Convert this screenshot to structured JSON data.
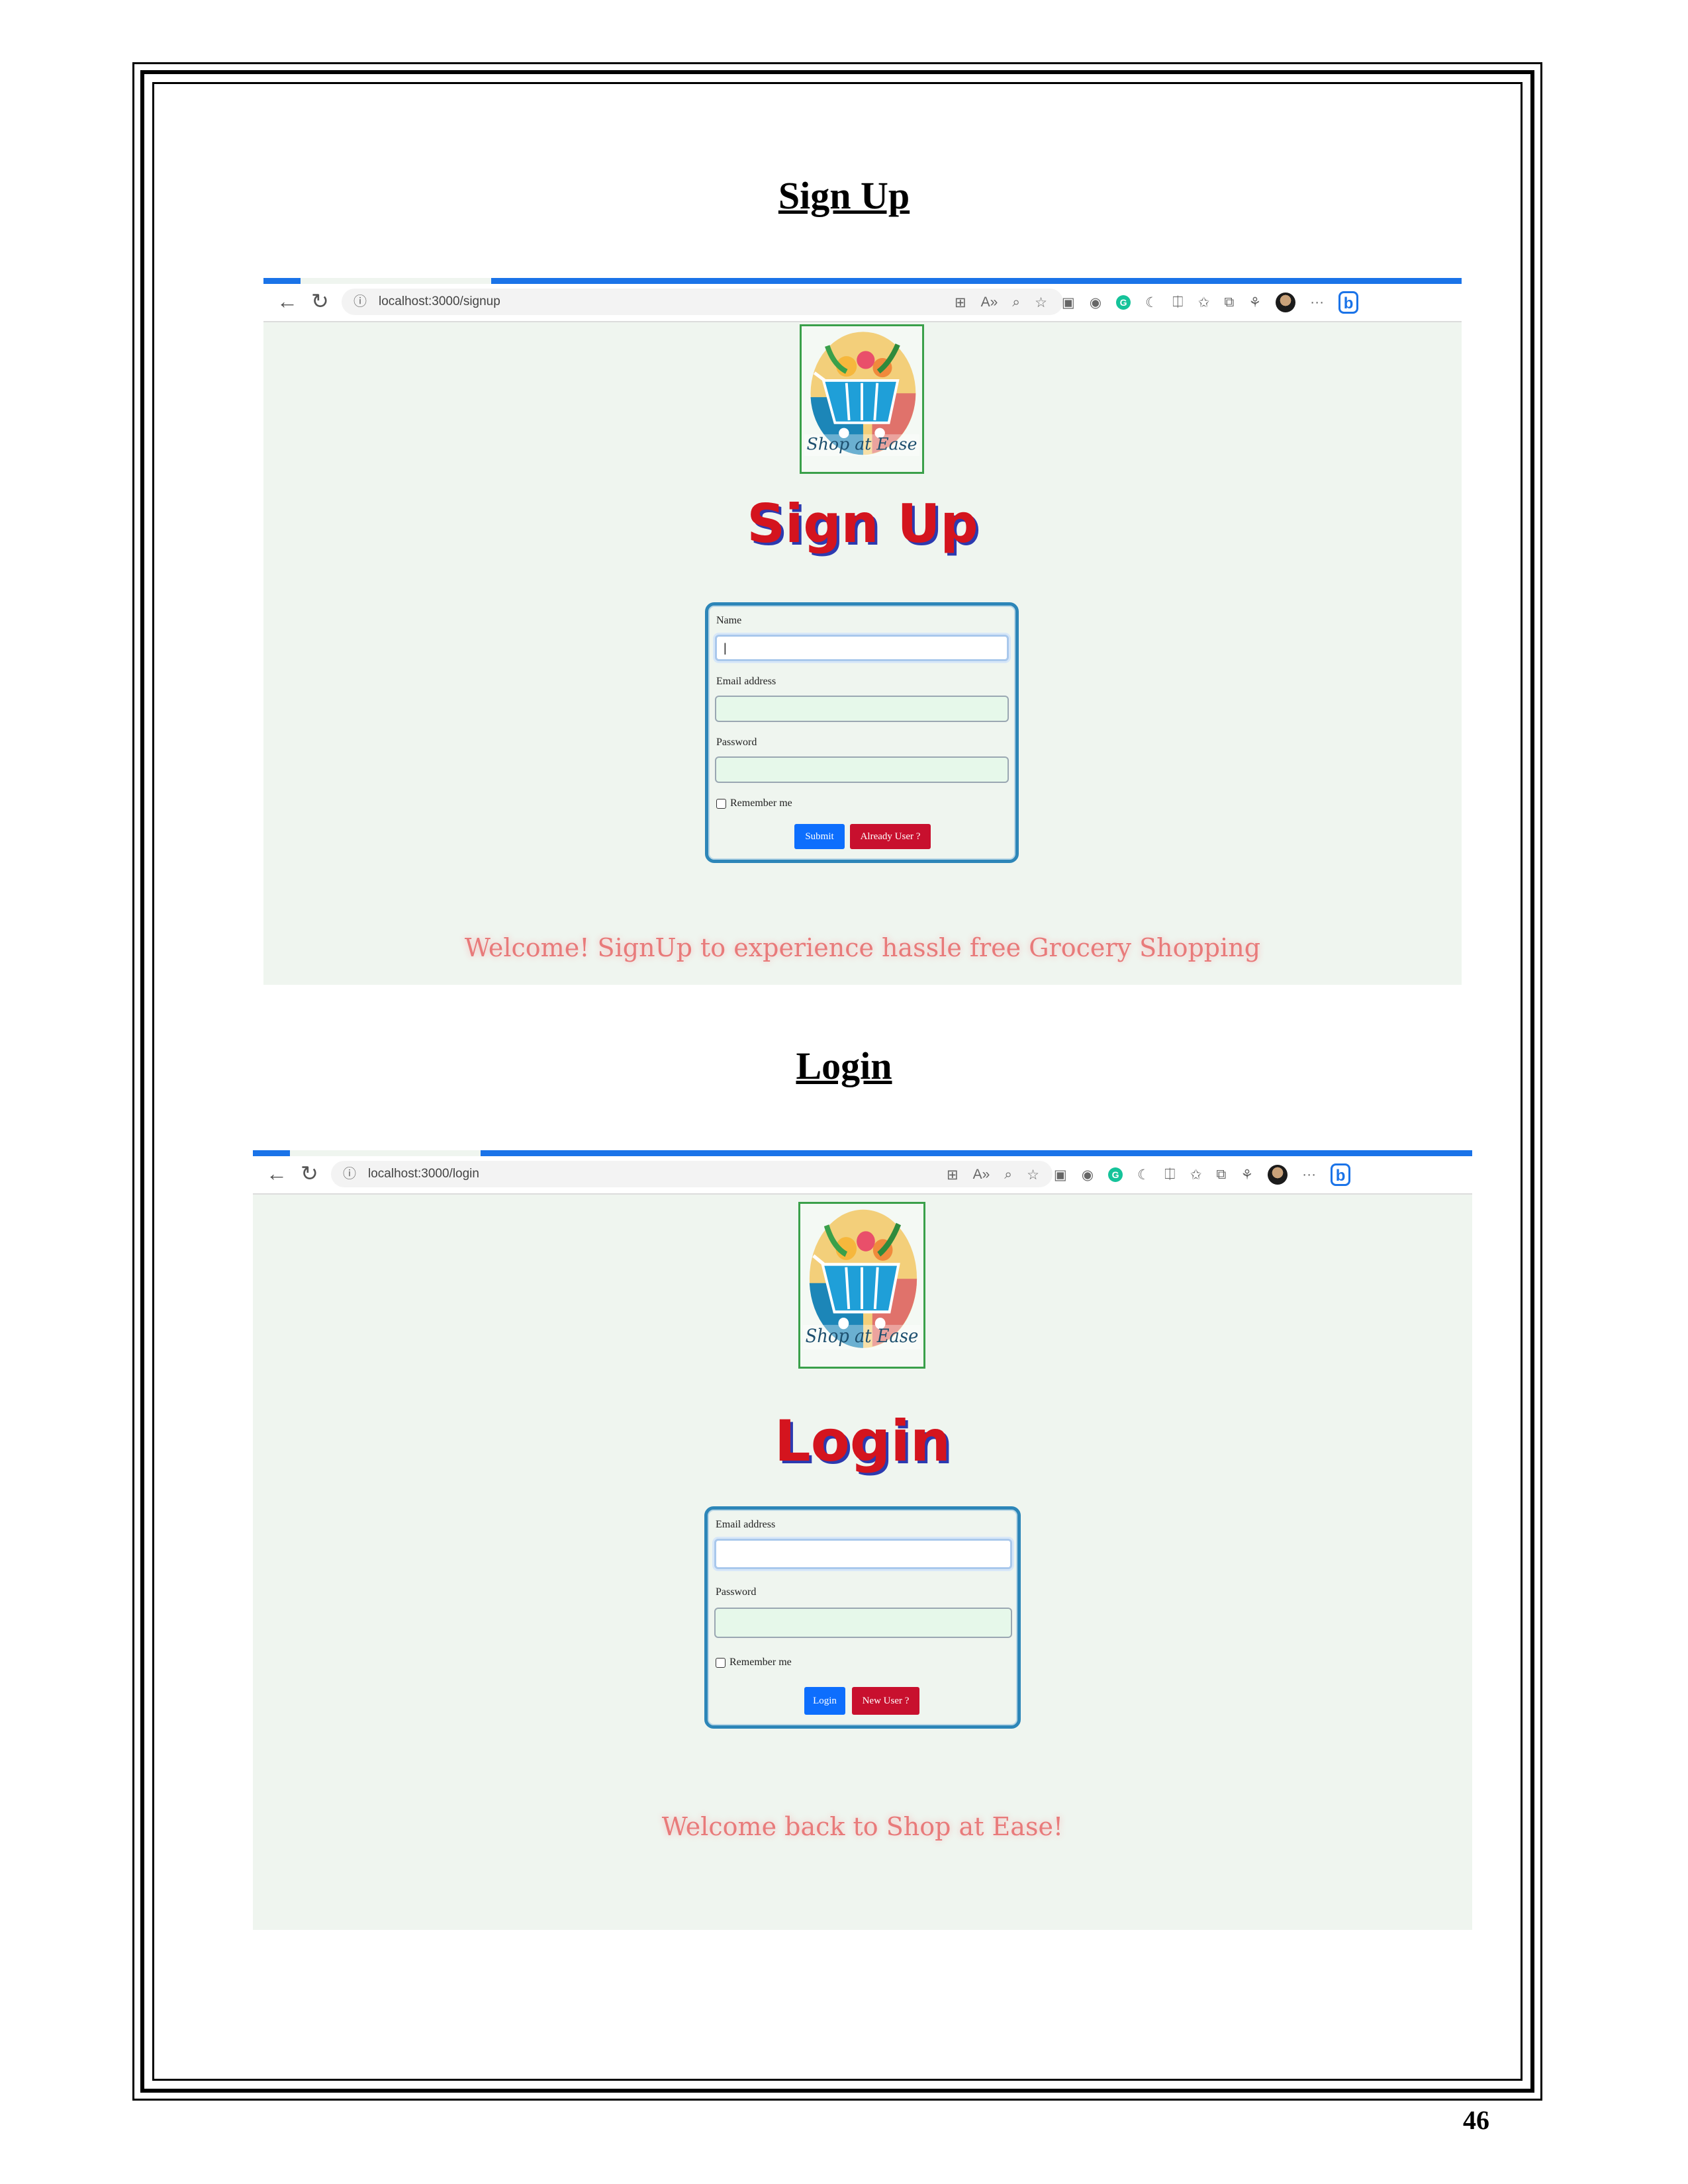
{
  "page": {
    "number": "46"
  },
  "sections": {
    "signup": {
      "heading": "Sign Up",
      "browser": {
        "url": "localhost:3000/signup"
      },
      "app": {
        "logo_text": "Shop at Ease",
        "title": "Sign Up",
        "form": {
          "name_label": "Name",
          "name_value": "|",
          "email_label": "Email address",
          "password_label": "Password",
          "remember_label": "Remember me",
          "submit_label": "Submit",
          "secondary_label": "Already User ?"
        },
        "welcome": "Welcome! SignUp to experience hassle free Grocery Shopping"
      }
    },
    "login": {
      "heading": "Login",
      "browser": {
        "url": "localhost:3000/login"
      },
      "app": {
        "logo_text": "Shop at Ease",
        "title": "Login",
        "form": {
          "email_label": "Email address",
          "password_label": "Password",
          "remember_label": "Remember me",
          "submit_label": "Login",
          "secondary_label": "New User ?"
        },
        "welcome": "Welcome back to Shop at Ease!"
      }
    }
  },
  "toolbar_icons": [
    "grid-icon",
    "read-aloud-icon",
    "zoom-icon",
    "favorite-star-icon",
    "extension-icon",
    "extension-icon",
    "grammarly-icon",
    "extension-icon",
    "split-screen-icon",
    "favorites-icon",
    "collections-icon",
    "extension-icon",
    "profile-avatar-icon",
    "more-icon",
    "bing-icon"
  ],
  "colors": {
    "accent": "#1a73e8",
    "title_red": "#d4141e",
    "button_blue": "#0d6efd",
    "button_red": "#c8102e",
    "welcome_pink": "#e87a7a",
    "page_bg": "#eff5ef"
  }
}
